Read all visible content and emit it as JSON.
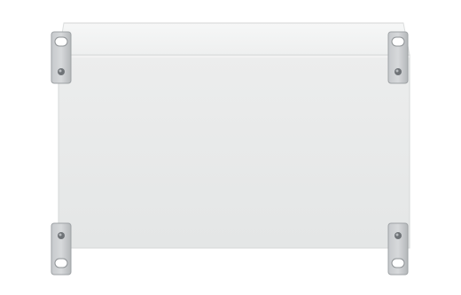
{
  "image": {
    "subject": "wall-mount-enclosure-panel",
    "colors": {
      "background": "#ffffff",
      "panel_face": "#e9eaea",
      "panel_top_band": "#f2f3f3",
      "panel_edge": "#d6d8d8",
      "bracket_metal": "#b9bcbf",
      "bracket_dark": "#8f9396",
      "screw": "#6f7377"
    },
    "mounting_brackets": [
      {
        "position": "top-left"
      },
      {
        "position": "top-right"
      },
      {
        "position": "bottom-left"
      },
      {
        "position": "bottom-right"
      }
    ]
  }
}
